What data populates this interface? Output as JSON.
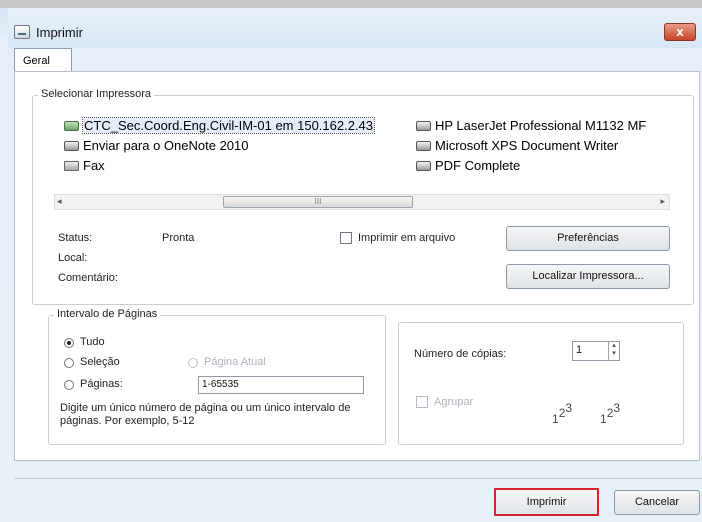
{
  "window": {
    "title": "Imprimir",
    "close_glyph": "x"
  },
  "tabs": [
    {
      "label": "Geral"
    }
  ],
  "printer_group": {
    "legend": "Selecionar Impressora",
    "printers": [
      {
        "label": "CTC_Sec.Coord.Eng.Civil-IM-01 em 150.162.2.43",
        "icon": "network-printer-icon",
        "selected": true
      },
      {
        "label": "Enviar para o OneNote 2010",
        "icon": "printer-icon"
      },
      {
        "label": "Fax",
        "icon": "fax-icon"
      },
      {
        "label": "HP LaserJet Professional M1132 MF",
        "icon": "printer-icon"
      },
      {
        "label": "Microsoft XPS Document Writer",
        "icon": "printer-icon"
      },
      {
        "label": "PDF Complete",
        "icon": "printer-icon"
      }
    ],
    "scroll_thumb_grip": "III",
    "status_label": "Status:",
    "status_value": "Pronta",
    "local_label": "Local:",
    "comment_label": "Comentário:",
    "print_to_file_label": "Imprimir em arquivo",
    "preferences_button": "Preferências",
    "find_printer_button": "Localizar Impressora..."
  },
  "page_range": {
    "legend": "Intervalo de Páginas",
    "all_label": "Tudo",
    "selection_label": "Seleção",
    "current_page_label": "Página Atual",
    "pages_label": "Páginas:",
    "pages_value": "1-65535",
    "hint": "Digite um único número de página ou um único intervalo de páginas. Por exemplo, 5-12",
    "selected": "all"
  },
  "copies": {
    "label": "Número de cópias:",
    "value": "1",
    "collate_label": "Agrupar"
  },
  "footer": {
    "print_button": "Imprimir",
    "cancel_button": "Cancelar"
  }
}
